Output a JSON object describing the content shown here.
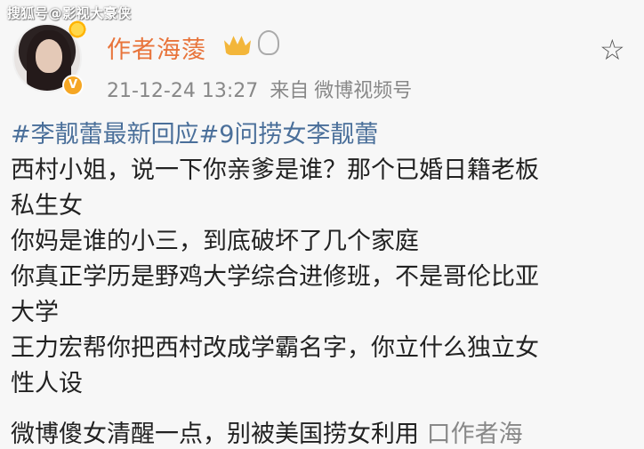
{
  "watermark": "搜狐号@影视大豪侠",
  "header": {
    "username": "作者海蔆",
    "timestamp": "21-12-24 13:27",
    "source_prefix": "来自",
    "source": "微博视频号",
    "badge_letter": "V"
  },
  "post": {
    "hashtags": "#李靓蕾最新回应#9问捞女李靓蕾",
    "lines": [
      "西村小姐，说一下你亲爹是谁？那个已婚日籍老板",
      "私生女",
      "你妈是谁的小三，到底破坏了几个家庭",
      "你真正学历是野鸡大学综合进修班，不是哥伦比亚",
      "大学",
      "王力宏帮你把西村改成学霸名字，你立什么独立女",
      "性人设"
    ],
    "last_line": "微博傻女清醒一点，别被美国捞女利用",
    "last_line_tail": "口作者海"
  },
  "colors": {
    "username": "#e8743b",
    "hashtag": "#4a6f9a",
    "meta": "#888888"
  }
}
